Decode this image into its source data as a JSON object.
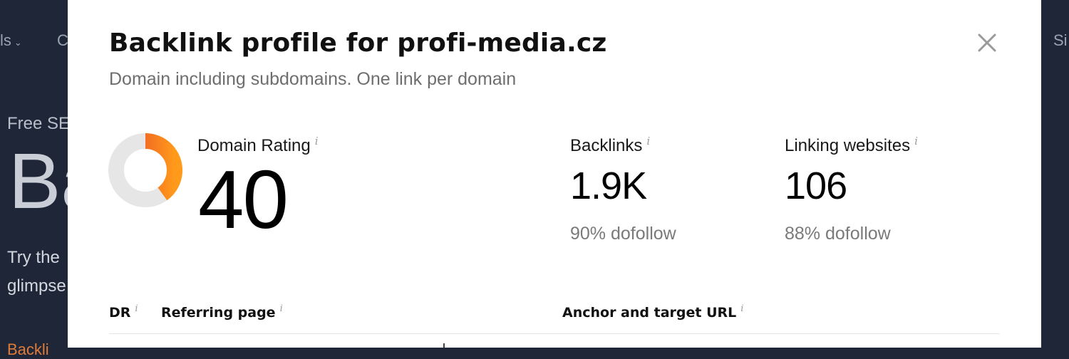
{
  "background": {
    "nav_left": "ls",
    "nav_left_second": "C",
    "nav_right": "Si",
    "eyebrow": "Free SE",
    "hero": "Ba",
    "desc_line1": "Try the",
    "desc_line2": "glimpse",
    "link": "Backli"
  },
  "modal": {
    "title": "Backlink profile for profi-media.cz",
    "subtitle": "Domain including subdomains. One link per domain",
    "close_icon": "close-icon"
  },
  "metrics": {
    "domain_rating": {
      "label": "Domain Rating",
      "value": "40",
      "fraction": 0.4
    },
    "backlinks": {
      "label": "Backlinks",
      "value": "1.9K",
      "sub": "90% dofollow"
    },
    "linking_websites": {
      "label": "Linking websites",
      "value": "106",
      "sub": "88% dofollow"
    },
    "info_glyph": "i"
  },
  "table": {
    "columns": [
      "DR",
      "Referring page",
      "Anchor and target URL"
    ]
  },
  "colors": {
    "donut_start": "#e8412c",
    "donut_end": "#ff9a1a",
    "donut_track": "#e6e6e6",
    "background": "#1e2638"
  }
}
